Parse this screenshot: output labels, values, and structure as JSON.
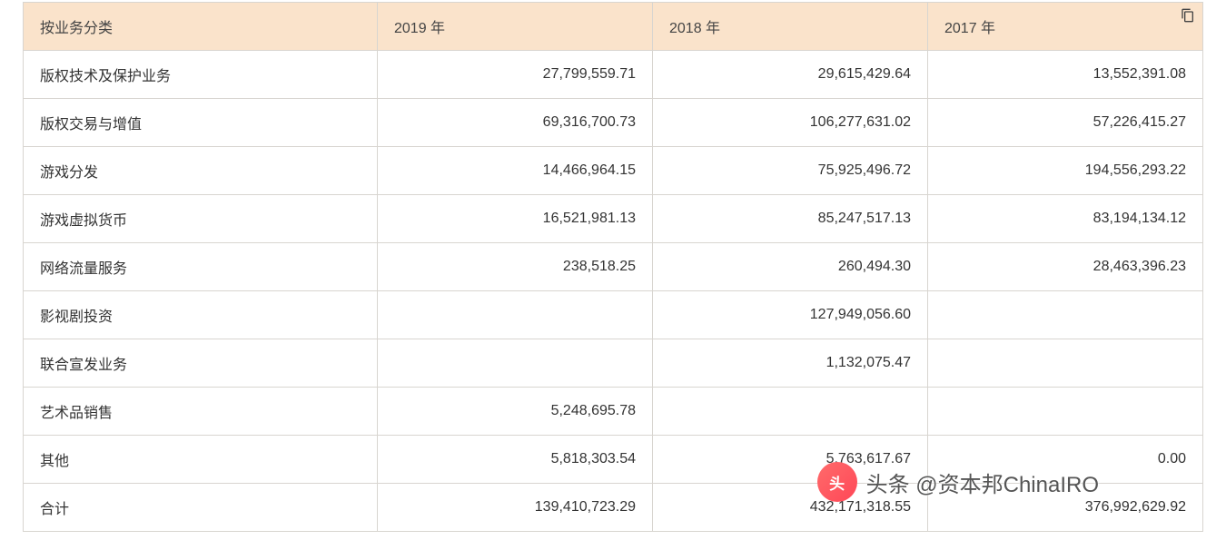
{
  "chart_data": {
    "type": "table",
    "title": "",
    "columns": [
      "按业务分类",
      "2019 年",
      "2018 年",
      "2017 年"
    ],
    "rows": [
      {
        "label": "版权技术及保护业务",
        "y2019": "27,799,559.71",
        "y2018": "29,615,429.64",
        "y2017": "13,552,391.08"
      },
      {
        "label": "版权交易与增值",
        "y2019": "69,316,700.73",
        "y2018": "106,277,631.02",
        "y2017": "57,226,415.27"
      },
      {
        "label": "游戏分发",
        "y2019": "14,466,964.15",
        "y2018": "75,925,496.72",
        "y2017": "194,556,293.22"
      },
      {
        "label": "游戏虚拟货币",
        "y2019": "16,521,981.13",
        "y2018": "85,247,517.13",
        "y2017": "83,194,134.12"
      },
      {
        "label": "网络流量服务",
        "y2019": "238,518.25",
        "y2018": "260,494.30",
        "y2017": "28,463,396.23"
      },
      {
        "label": "影视剧投资",
        "y2019": "",
        "y2018": "127,949,056.60",
        "y2017": ""
      },
      {
        "label": "联合宣发业务",
        "y2019": "",
        "y2018": "1,132,075.47",
        "y2017": ""
      },
      {
        "label": "艺术品销售",
        "y2019": "5,248,695.78",
        "y2018": "",
        "y2017": ""
      },
      {
        "label": "其他",
        "y2019": "5,818,303.54",
        "y2018": "5,763,617.67",
        "y2017": "0.00"
      },
      {
        "label": "合计",
        "y2019": "139,410,723.29",
        "y2018": "432,171,318.55",
        "y2017": "376,992,629.92"
      }
    ]
  },
  "watermark": {
    "logo_text": "头条",
    "text": "头条 @资本邦ChinaIRO"
  }
}
